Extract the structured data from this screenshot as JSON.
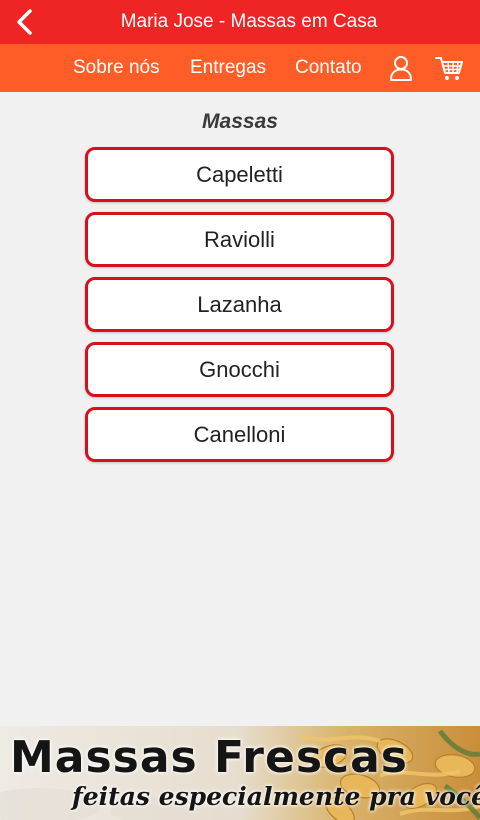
{
  "header": {
    "title": "Maria Jose - Massas em Casa",
    "back_icon": "chevron-left-icon"
  },
  "nav": {
    "links": [
      "Sobre nós",
      "Entregas",
      "Contato"
    ],
    "user_icon": "user-icon",
    "cart_icon": "shopping-cart-icon"
  },
  "main": {
    "section_title": "Massas",
    "items": [
      "Capeletti",
      "Raviolli",
      "Lazanha",
      "Gnocchi",
      "Canelloni"
    ]
  },
  "banner": {
    "title": "Massas Frescas",
    "subtitle": "feitas especialmente pra você"
  },
  "colors": {
    "header_bg": "#ee2524",
    "nav_bg": "#fe5d27",
    "button_border": "#d5111c",
    "page_bg": "#f1f1f1"
  }
}
